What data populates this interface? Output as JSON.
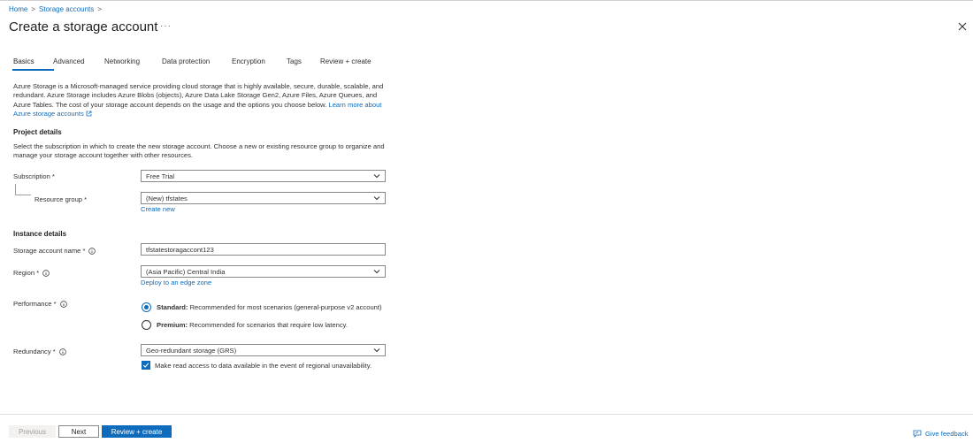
{
  "breadcrumb": {
    "home": "Home",
    "storage_accounts": "Storage accounts"
  },
  "header": {
    "title": "Create a storage account",
    "more": "···"
  },
  "tabs": [
    {
      "label": "Basics",
      "active": true
    },
    {
      "label": "Advanced"
    },
    {
      "label": "Networking"
    },
    {
      "label": "Data protection"
    },
    {
      "label": "Encryption"
    },
    {
      "label": "Tags"
    },
    {
      "label": "Review + create"
    }
  ],
  "intro": {
    "text": "Azure Storage is a Microsoft-managed service providing cloud storage that is highly available, secure, durable, scalable, and redundant. Azure Storage includes Azure Blobs (objects), Azure Data Lake Storage Gen2, Azure Files, Azure Queues, and Azure Tables. The cost of your storage account depends on the usage and the options you choose below.",
    "link": "Learn more about Azure storage accounts"
  },
  "project": {
    "heading": "Project details",
    "description": "Select the subscription in which to create the new storage account. Choose a new or existing resource group to organize and manage your storage account together with other resources.",
    "subscription_label": "Subscription *",
    "subscription_value": "Free Trial",
    "resource_group_label": "Resource group *",
    "resource_group_value": "(New) tfstates",
    "create_new": "Create new"
  },
  "instance": {
    "heading": "Instance details",
    "name_label": "Storage account name *",
    "name_value": "tfstatestoragaccont123",
    "region_label": "Region *",
    "region_value": "(Asia Pacific) Central India",
    "edge_zone": "Deploy to an edge zone",
    "performance_label": "Performance *",
    "standard_title": "Standard:",
    "standard_desc": "Recommended for most scenarios (general-purpose v2 account)",
    "premium_title": "Premium:",
    "premium_desc": "Recommended for scenarios that require low latency.",
    "redundancy_label": "Redundancy *",
    "redundancy_value": "Geo-redundant storage (GRS)",
    "read_access": "Make read access to data available in the event of regional unavailability."
  },
  "footer": {
    "previous": "Previous",
    "next": "Next",
    "review": "Review + create",
    "feedback": "Give feedback"
  },
  "colors": {
    "accent": "#0f6cbd"
  }
}
